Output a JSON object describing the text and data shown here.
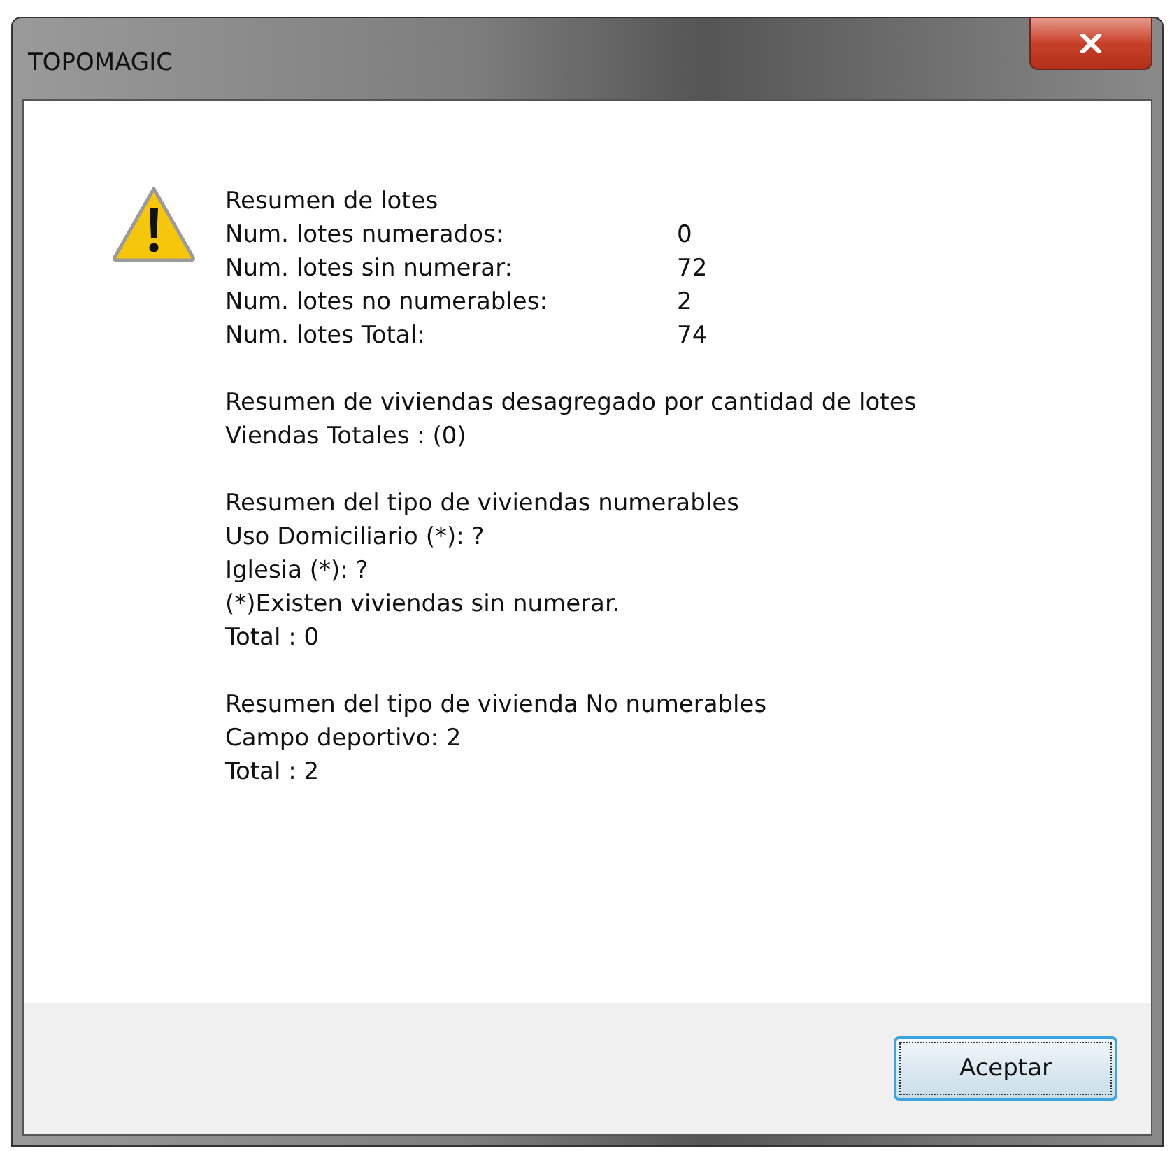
{
  "window": {
    "title": "TOPOMAGIC"
  },
  "lotes": {
    "heading": "Resumen de lotes",
    "rows": [
      {
        "label": "Num. lotes numerados:",
        "value": "0"
      },
      {
        "label": "Num. lotes sin numerar:",
        "value": "72"
      },
      {
        "label": "Num. lotes no numerables:",
        "value": "2"
      },
      {
        "label": "Num. lotes Total:",
        "value": "74"
      }
    ]
  },
  "sections": [
    [
      "Resumen de viviendas desagregado por cantidad de lotes",
      "Viendas Totales : (0)"
    ],
    [
      "Resumen del tipo de viviendas numerables",
      "Uso Domiciliario (*): ?",
      "Iglesia (*): ?",
      "(*)Existen viviendas sin numerar.",
      "Total : 0"
    ],
    [
      "Resumen del tipo de vivienda No numerables",
      "Campo deportivo: 2",
      "Total : 2"
    ]
  ],
  "buttons": [
    "Aceptar"
  ]
}
